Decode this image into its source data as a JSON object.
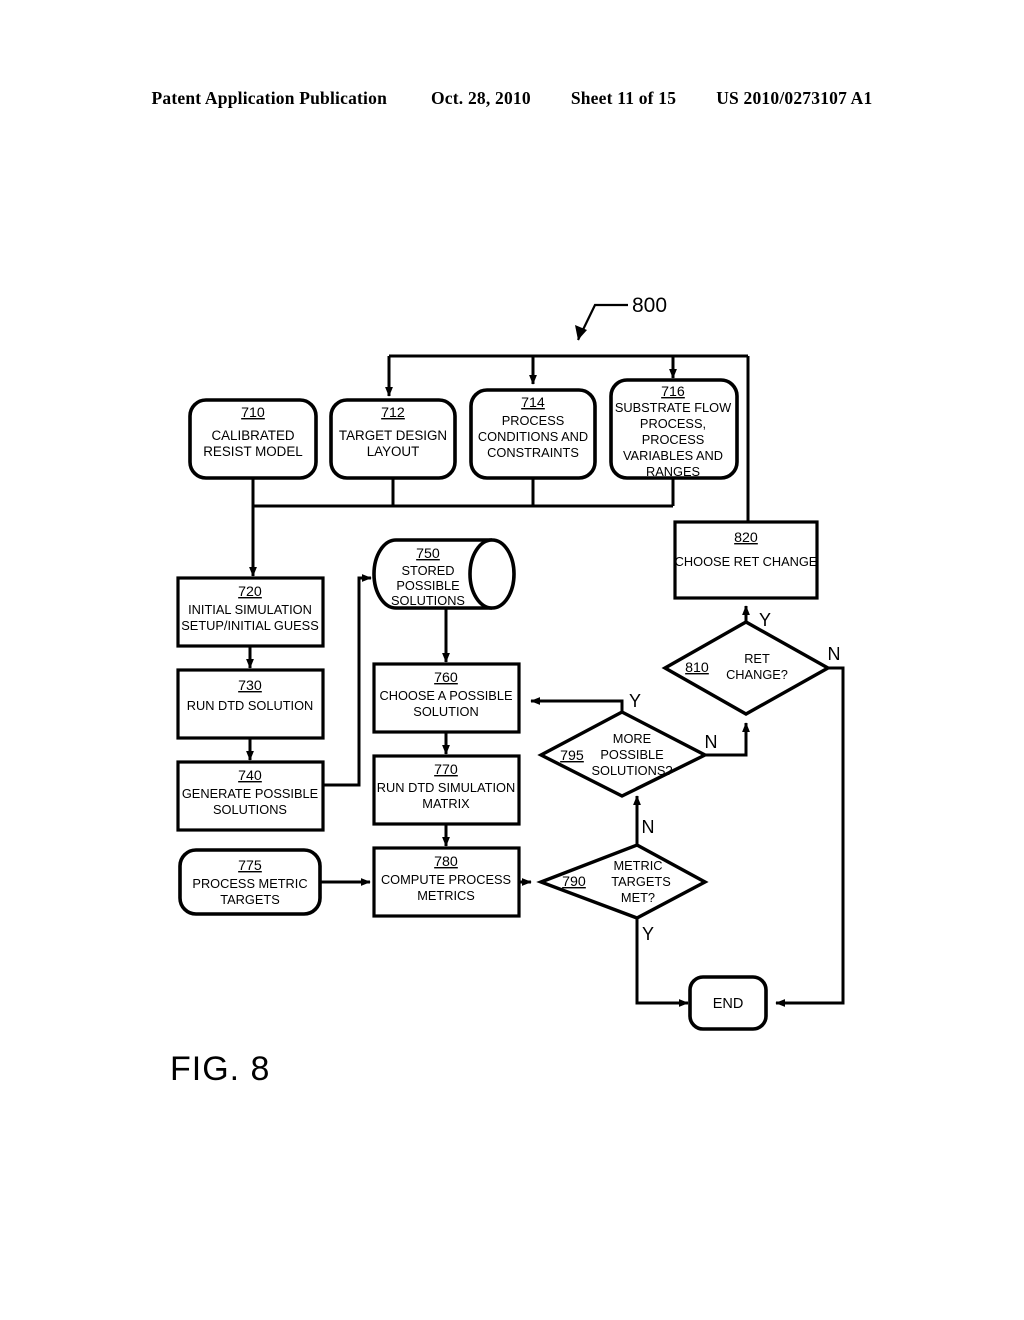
{
  "header": {
    "publication": "Patent Application Publication",
    "date": "Oct. 28, 2010",
    "sheet": "Sheet 11 of 15",
    "patent_number": "US 2010/0273107 A1"
  },
  "figure": {
    "caption": "FIG. 8",
    "diagram_ref": "800"
  },
  "nodes": {
    "n710": {
      "ref": "710",
      "lines": [
        "CALIBRATED",
        "RESIST MODEL"
      ],
      "shape": "rounded-rect"
    },
    "n712": {
      "ref": "712",
      "lines": [
        "TARGET DESIGN",
        "LAYOUT"
      ],
      "shape": "rounded-rect"
    },
    "n714": {
      "ref": "714",
      "lines": [
        "PROCESS",
        "CONDITIONS AND",
        "CONSTRAINTS"
      ],
      "shape": "rounded-rect"
    },
    "n716": {
      "ref": "716",
      "lines": [
        "SUBSTRATE FLOW",
        "PROCESS,",
        "PROCESS",
        "VARIABLES AND",
        "RANGES"
      ],
      "shape": "rounded-rect"
    },
    "n720": {
      "ref": "720",
      "lines": [
        "INITIAL SIMULATION",
        "SETUP/INITIAL GUESS"
      ],
      "shape": "rect"
    },
    "n730": {
      "ref": "730",
      "lines": [
        "RUN DTD SOLUTION"
      ],
      "shape": "rect"
    },
    "n740": {
      "ref": "740",
      "lines": [
        "GENERATE POSSIBLE",
        "SOLUTIONS"
      ],
      "shape": "rect"
    },
    "n750": {
      "ref": "750",
      "lines": [
        "STORED",
        "POSSIBLE",
        "SOLUTIONS"
      ],
      "shape": "cylinder"
    },
    "n760": {
      "ref": "760",
      "lines": [
        "CHOOSE A POSSIBLE",
        "SOLUTION"
      ],
      "shape": "rect"
    },
    "n770": {
      "ref": "770",
      "lines": [
        "RUN DTD SIMULATION",
        "MATRIX"
      ],
      "shape": "rect"
    },
    "n775": {
      "ref": "775",
      "lines": [
        "PROCESS METRIC",
        "TARGETS"
      ],
      "shape": "rounded-rect"
    },
    "n780": {
      "ref": "780",
      "lines": [
        "COMPUTE PROCESS",
        "METRICS"
      ],
      "shape": "rect"
    },
    "n790": {
      "ref": "790",
      "lines": [
        "METRIC",
        "TARGETS",
        "MET?"
      ],
      "shape": "diamond"
    },
    "n795": {
      "ref": "795",
      "lines": [
        "MORE",
        "POSSIBLE",
        "SOLUTIONS?"
      ],
      "shape": "diamond"
    },
    "n810": {
      "ref": "810",
      "lines": [
        "RET",
        "CHANGE?"
      ],
      "shape": "diamond"
    },
    "n820": {
      "ref": "820",
      "lines": [
        "CHOOSE RET CHANGE"
      ],
      "shape": "rect"
    },
    "nend": {
      "ref": "",
      "lines": [
        "END"
      ],
      "shape": "rounded-rect"
    }
  },
  "edge_labels": {
    "e790_yes": "Y",
    "e790_no": "N",
    "e795_yes": "Y",
    "e795_no": "N",
    "e810_yes": "Y",
    "e810_no": "N"
  },
  "colors": {
    "ink": "#000000",
    "paper": "#ffffff"
  }
}
